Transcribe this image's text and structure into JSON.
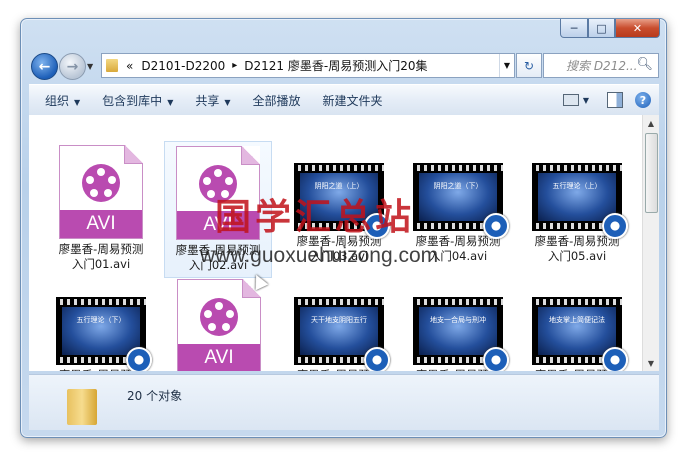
{
  "window": {
    "buttons": {
      "minimize": "─",
      "maximize": "□",
      "close": "✕"
    }
  },
  "nav": {
    "address": {
      "prefix": "«",
      "crumbs": [
        "D2101-D2200",
        "D2121 廖墨香-周易预测入门20集"
      ],
      "separator": "▸"
    },
    "refresh_icon": "↻",
    "search_placeholder": "搜索 D212..."
  },
  "toolbar": {
    "organize": "组织",
    "include_in_library": "包含到库中",
    "share": "共享",
    "play_all": "全部播放",
    "new_folder": "新建文件夹"
  },
  "files": [
    {
      "line1": "廖墨香-周易预测",
      "line2": "入门01.avi",
      "type": "avi"
    },
    {
      "line1": "廖墨香-周易预测",
      "line2": "入门02.avi",
      "type": "avi"
    },
    {
      "line1": "廖墨香-周易预测",
      "line2": "入门03.avi",
      "type": "video",
      "thumb_text": "阴阳之道（上）"
    },
    {
      "line1": "廖墨香-周易预测",
      "line2": "入门04.avi",
      "type": "video",
      "thumb_text": "阴阳之道（下）"
    },
    {
      "line1": "廖墨香-周易预测",
      "line2": "入门05.avi",
      "type": "video",
      "thumb_text": "五行理论（上）"
    },
    {
      "line1": "廖墨香-周易预测",
      "line2": "",
      "type": "video",
      "thumb_text": "五行理论（下）"
    },
    {
      "line1": "廖墨香-周易预测",
      "line2": "",
      "type": "avi"
    },
    {
      "line1": "廖墨香-周易预测",
      "line2": "",
      "type": "video",
      "thumb_text": "天干地支阴阳五行"
    },
    {
      "line1": "廖墨香-周易预测",
      "line2": "",
      "type": "video",
      "thumb_text": "地支一合局与刑冲"
    },
    {
      "line1": "廖墨香-周易预测",
      "line2": "",
      "type": "video",
      "thumb_text": "地支掌上简便记法"
    }
  ],
  "avi_label": "AVI",
  "status": {
    "count_text": "20 个对象"
  },
  "watermark": {
    "line1": "国学汇总站",
    "line2": "www.guoxuehuizong.com"
  }
}
